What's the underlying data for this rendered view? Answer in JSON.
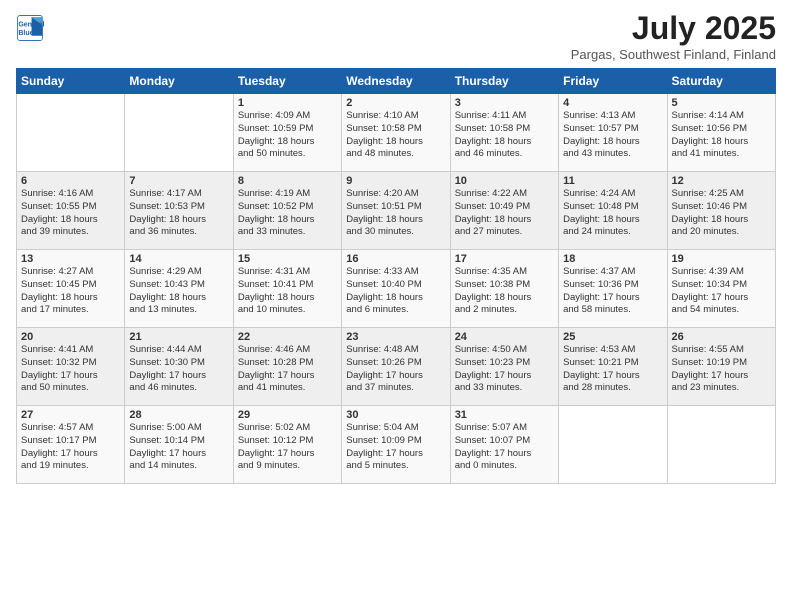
{
  "header": {
    "logo_line1": "General",
    "logo_line2": "Blue",
    "title": "July 2025",
    "subtitle": "Pargas, Southwest Finland, Finland"
  },
  "weekdays": [
    "Sunday",
    "Monday",
    "Tuesday",
    "Wednesday",
    "Thursday",
    "Friday",
    "Saturday"
  ],
  "rows": [
    [
      {
        "day": "",
        "lines": []
      },
      {
        "day": "",
        "lines": []
      },
      {
        "day": "1",
        "lines": [
          "Sunrise: 4:09 AM",
          "Sunset: 10:59 PM",
          "Daylight: 18 hours",
          "and 50 minutes."
        ]
      },
      {
        "day": "2",
        "lines": [
          "Sunrise: 4:10 AM",
          "Sunset: 10:58 PM",
          "Daylight: 18 hours",
          "and 48 minutes."
        ]
      },
      {
        "day": "3",
        "lines": [
          "Sunrise: 4:11 AM",
          "Sunset: 10:58 PM",
          "Daylight: 18 hours",
          "and 46 minutes."
        ]
      },
      {
        "day": "4",
        "lines": [
          "Sunrise: 4:13 AM",
          "Sunset: 10:57 PM",
          "Daylight: 18 hours",
          "and 43 minutes."
        ]
      },
      {
        "day": "5",
        "lines": [
          "Sunrise: 4:14 AM",
          "Sunset: 10:56 PM",
          "Daylight: 18 hours",
          "and 41 minutes."
        ]
      }
    ],
    [
      {
        "day": "6",
        "lines": [
          "Sunrise: 4:16 AM",
          "Sunset: 10:55 PM",
          "Daylight: 18 hours",
          "and 39 minutes."
        ]
      },
      {
        "day": "7",
        "lines": [
          "Sunrise: 4:17 AM",
          "Sunset: 10:53 PM",
          "Daylight: 18 hours",
          "and 36 minutes."
        ]
      },
      {
        "day": "8",
        "lines": [
          "Sunrise: 4:19 AM",
          "Sunset: 10:52 PM",
          "Daylight: 18 hours",
          "and 33 minutes."
        ]
      },
      {
        "day": "9",
        "lines": [
          "Sunrise: 4:20 AM",
          "Sunset: 10:51 PM",
          "Daylight: 18 hours",
          "and 30 minutes."
        ]
      },
      {
        "day": "10",
        "lines": [
          "Sunrise: 4:22 AM",
          "Sunset: 10:49 PM",
          "Daylight: 18 hours",
          "and 27 minutes."
        ]
      },
      {
        "day": "11",
        "lines": [
          "Sunrise: 4:24 AM",
          "Sunset: 10:48 PM",
          "Daylight: 18 hours",
          "and 24 minutes."
        ]
      },
      {
        "day": "12",
        "lines": [
          "Sunrise: 4:25 AM",
          "Sunset: 10:46 PM",
          "Daylight: 18 hours",
          "and 20 minutes."
        ]
      }
    ],
    [
      {
        "day": "13",
        "lines": [
          "Sunrise: 4:27 AM",
          "Sunset: 10:45 PM",
          "Daylight: 18 hours",
          "and 17 minutes."
        ]
      },
      {
        "day": "14",
        "lines": [
          "Sunrise: 4:29 AM",
          "Sunset: 10:43 PM",
          "Daylight: 18 hours",
          "and 13 minutes."
        ]
      },
      {
        "day": "15",
        "lines": [
          "Sunrise: 4:31 AM",
          "Sunset: 10:41 PM",
          "Daylight: 18 hours",
          "and 10 minutes."
        ]
      },
      {
        "day": "16",
        "lines": [
          "Sunrise: 4:33 AM",
          "Sunset: 10:40 PM",
          "Daylight: 18 hours",
          "and 6 minutes."
        ]
      },
      {
        "day": "17",
        "lines": [
          "Sunrise: 4:35 AM",
          "Sunset: 10:38 PM",
          "Daylight: 18 hours",
          "and 2 minutes."
        ]
      },
      {
        "day": "18",
        "lines": [
          "Sunrise: 4:37 AM",
          "Sunset: 10:36 PM",
          "Daylight: 17 hours",
          "and 58 minutes."
        ]
      },
      {
        "day": "19",
        "lines": [
          "Sunrise: 4:39 AM",
          "Sunset: 10:34 PM",
          "Daylight: 17 hours",
          "and 54 minutes."
        ]
      }
    ],
    [
      {
        "day": "20",
        "lines": [
          "Sunrise: 4:41 AM",
          "Sunset: 10:32 PM",
          "Daylight: 17 hours",
          "and 50 minutes."
        ]
      },
      {
        "day": "21",
        "lines": [
          "Sunrise: 4:44 AM",
          "Sunset: 10:30 PM",
          "Daylight: 17 hours",
          "and 46 minutes."
        ]
      },
      {
        "day": "22",
        "lines": [
          "Sunrise: 4:46 AM",
          "Sunset: 10:28 PM",
          "Daylight: 17 hours",
          "and 41 minutes."
        ]
      },
      {
        "day": "23",
        "lines": [
          "Sunrise: 4:48 AM",
          "Sunset: 10:26 PM",
          "Daylight: 17 hours",
          "and 37 minutes."
        ]
      },
      {
        "day": "24",
        "lines": [
          "Sunrise: 4:50 AM",
          "Sunset: 10:23 PM",
          "Daylight: 17 hours",
          "and 33 minutes."
        ]
      },
      {
        "day": "25",
        "lines": [
          "Sunrise: 4:53 AM",
          "Sunset: 10:21 PM",
          "Daylight: 17 hours",
          "and 28 minutes."
        ]
      },
      {
        "day": "26",
        "lines": [
          "Sunrise: 4:55 AM",
          "Sunset: 10:19 PM",
          "Daylight: 17 hours",
          "and 23 minutes."
        ]
      }
    ],
    [
      {
        "day": "27",
        "lines": [
          "Sunrise: 4:57 AM",
          "Sunset: 10:17 PM",
          "Daylight: 17 hours",
          "and 19 minutes."
        ]
      },
      {
        "day": "28",
        "lines": [
          "Sunrise: 5:00 AM",
          "Sunset: 10:14 PM",
          "Daylight: 17 hours",
          "and 14 minutes."
        ]
      },
      {
        "day": "29",
        "lines": [
          "Sunrise: 5:02 AM",
          "Sunset: 10:12 PM",
          "Daylight: 17 hours",
          "and 9 minutes."
        ]
      },
      {
        "day": "30",
        "lines": [
          "Sunrise: 5:04 AM",
          "Sunset: 10:09 PM",
          "Daylight: 17 hours",
          "and 5 minutes."
        ]
      },
      {
        "day": "31",
        "lines": [
          "Sunrise: 5:07 AM",
          "Sunset: 10:07 PM",
          "Daylight: 17 hours",
          "and 0 minutes."
        ]
      },
      {
        "day": "",
        "lines": []
      },
      {
        "day": "",
        "lines": []
      }
    ]
  ]
}
